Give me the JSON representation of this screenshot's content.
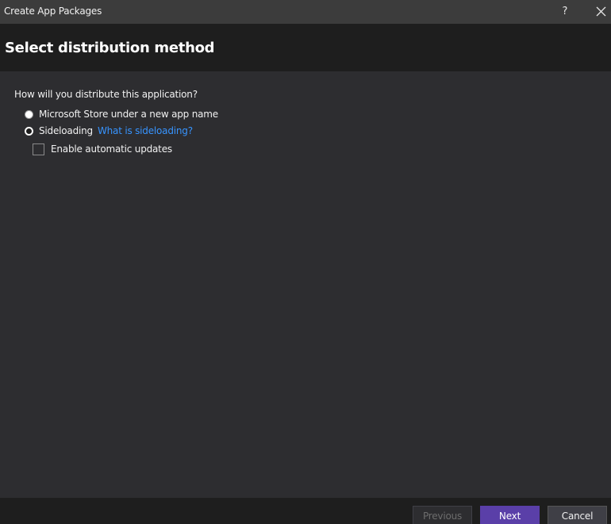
{
  "window": {
    "title": "Create App Packages",
    "help_label": "?",
    "close_icon": "close-icon"
  },
  "header": {
    "title": "Select distribution method"
  },
  "main": {
    "question": "How will you distribute this application?",
    "options": [
      {
        "label": "Microsoft Store under a new app name",
        "selected": false
      },
      {
        "label": "Sideloading",
        "selected": true,
        "link_text": "What is sideloading?"
      }
    ],
    "auto_update": {
      "label": "Enable automatic updates",
      "checked": false
    }
  },
  "footer": {
    "previous_label": "Previous",
    "next_label": "Next",
    "cancel_label": "Cancel"
  },
  "colors": {
    "accent": "#5a3fa8",
    "link": "#3794ff",
    "background": "#2d2d30",
    "header_background": "#1e1e1e",
    "titlebar_background": "#3c3c3c"
  }
}
